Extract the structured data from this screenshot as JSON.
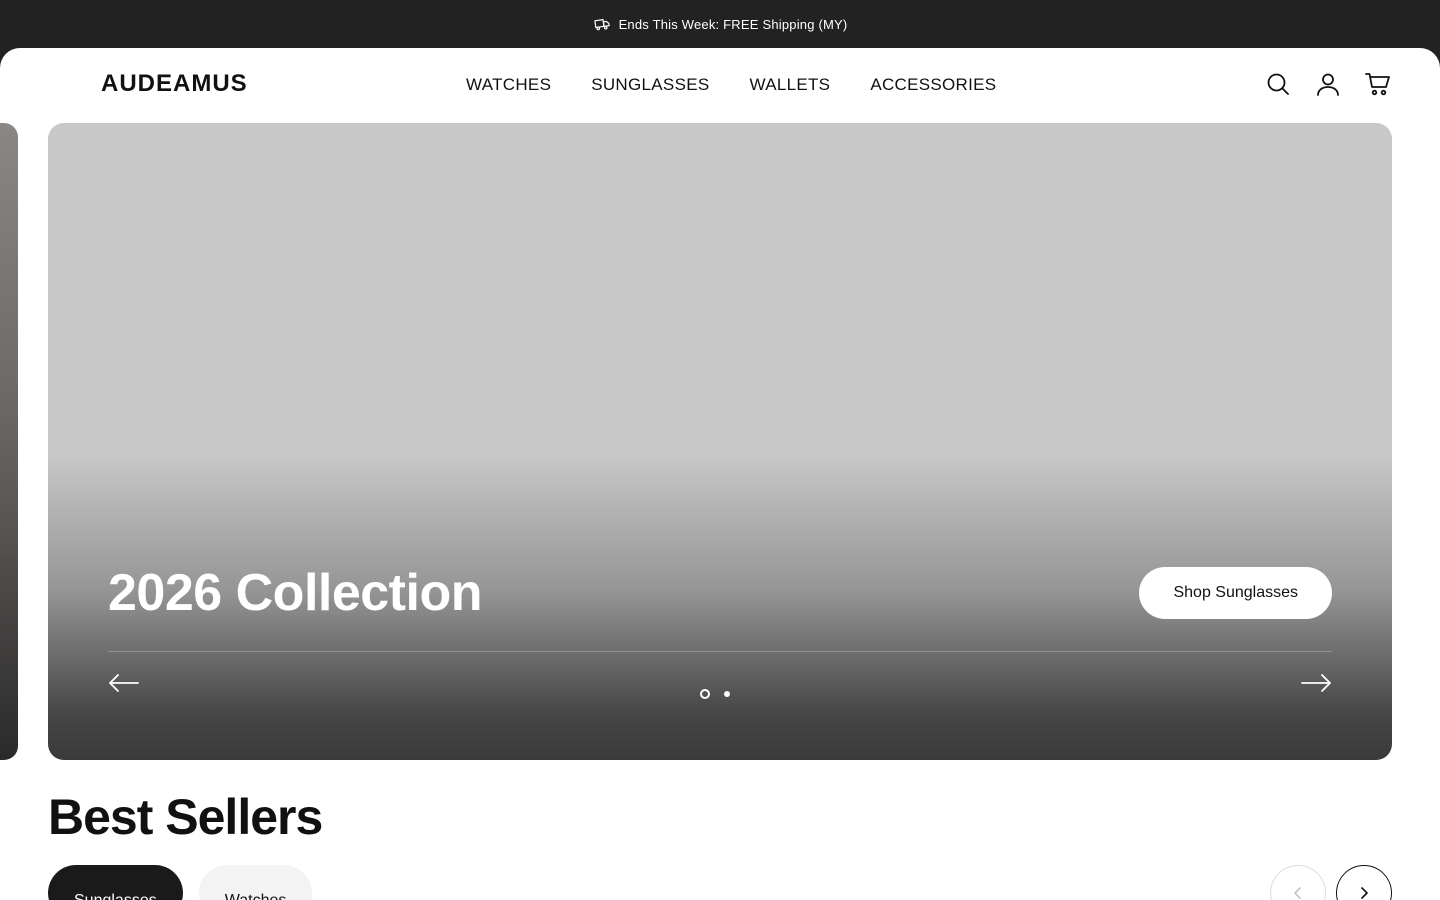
{
  "announcement": {
    "text": "Ends This Week: FREE Shipping (MY)",
    "icon": "delivery-truck-icon"
  },
  "header": {
    "logo": "AUDEAMUS",
    "nav": [
      "WATCHES",
      "SUNGLASSES",
      "WALLETS",
      "ACCESSORIES"
    ],
    "icons": [
      "search-icon",
      "account-icon",
      "cart-icon"
    ]
  },
  "hero": {
    "title": "2026 Collection",
    "cta_label": "Shop Sunglasses",
    "slide_count": 2,
    "active_slide": 1
  },
  "best_sellers": {
    "title": "Best Sellers",
    "tabs": [
      "Sunglasses",
      "Watches"
    ],
    "active_tab": "Sunglasses"
  },
  "colors": {
    "announce_bg": "#222222",
    "hero_bg": "#c8c8c8",
    "active_tab_bg": "#1a1a1a"
  }
}
